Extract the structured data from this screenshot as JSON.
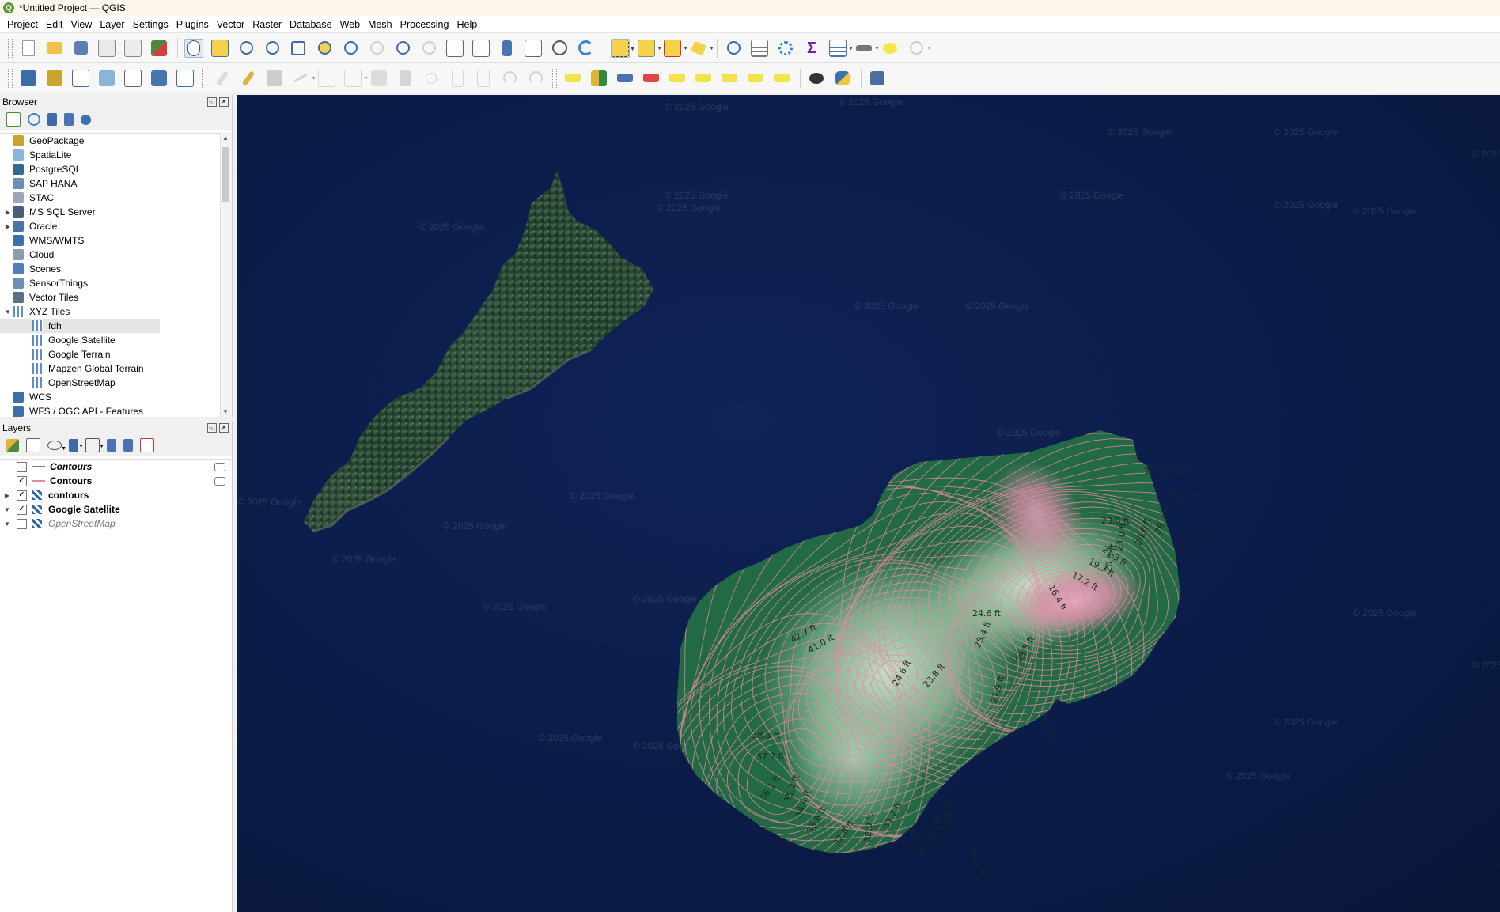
{
  "window": {
    "title": "*Untitled Project — QGIS",
    "logo": "Q"
  },
  "menu": [
    "Project",
    "Edit",
    "View",
    "Layer",
    "Settings",
    "Plugins",
    "Vector",
    "Raster",
    "Database",
    "Web",
    "Mesh",
    "Processing",
    "Help"
  ],
  "browser": {
    "title": "Browser",
    "items": [
      {
        "label": "GeoPackage",
        "icon": "geopackage-icon",
        "expand": "",
        "indent": 0,
        "color": "#c9a431"
      },
      {
        "label": "SpatiaLite",
        "icon": "spatialite-icon",
        "expand": "",
        "indent": 0,
        "color": "#8ab4d8"
      },
      {
        "label": "PostgreSQL",
        "icon": "postgresql-icon",
        "expand": "",
        "indent": 0,
        "color": "#336791"
      },
      {
        "label": "SAP HANA",
        "icon": "sap-hana-icon",
        "expand": "",
        "indent": 0,
        "color": "#6c8fb8"
      },
      {
        "label": "STAC",
        "icon": "stac-icon",
        "expand": "",
        "indent": 0,
        "color": "#9aa7b6"
      },
      {
        "label": "MS SQL Server",
        "icon": "mssql-icon",
        "expand": "▶",
        "indent": 0,
        "color": "#4b5d73"
      },
      {
        "label": "Oracle",
        "icon": "oracle-icon",
        "expand": "▶",
        "indent": 0,
        "color": "#4a73a8"
      },
      {
        "label": "WMS/WMTS",
        "icon": "wms-icon",
        "expand": "",
        "indent": 0,
        "color": "#3d6fa8"
      },
      {
        "label": "Cloud",
        "icon": "cloud-icon",
        "expand": "",
        "indent": 0,
        "color": "#8c9cb0"
      },
      {
        "label": "Scenes",
        "icon": "scenes-icon",
        "expand": "",
        "indent": 0,
        "color": "#4f7fb5"
      },
      {
        "label": "SensorThings",
        "icon": "sensorthings-icon",
        "expand": "",
        "indent": 0,
        "color": "#6f8fb2"
      },
      {
        "label": "Vector Tiles",
        "icon": "vector-tiles-icon",
        "expand": "",
        "indent": 0,
        "color": "#5b6f88"
      },
      {
        "label": "XYZ Tiles",
        "icon": "xyz-tiles-icon",
        "expand": "▼",
        "indent": 0,
        "color": "#5d8fc8"
      },
      {
        "label": "fdh",
        "icon": "xyz-tile-icon",
        "expand": "",
        "indent": 1,
        "color": "#5d8fc8",
        "selected": true
      },
      {
        "label": "Google Satellite",
        "icon": "xyz-tile-icon",
        "expand": "",
        "indent": 1,
        "color": "#5d8fc8"
      },
      {
        "label": "Google Terrain",
        "icon": "xyz-tile-icon",
        "expand": "",
        "indent": 1,
        "color": "#5d8fc8"
      },
      {
        "label": "Mapzen Global Terrain",
        "icon": "xyz-tile-icon",
        "expand": "",
        "indent": 1,
        "color": "#5d8fc8"
      },
      {
        "label": "OpenStreetMap",
        "icon": "xyz-tile-icon",
        "expand": "",
        "indent": 1,
        "color": "#5d8fc8"
      },
      {
        "label": "WCS",
        "icon": "wcs-icon",
        "expand": "",
        "indent": 0,
        "color": "#3d6fa8"
      },
      {
        "label": "WFS / OGC API - Features",
        "icon": "wfs-icon",
        "expand": "",
        "indent": 0,
        "color": "#3d6fa8"
      }
    ]
  },
  "layers": {
    "title": "Layers",
    "items": [
      {
        "label": "Contours",
        "checked": false,
        "symbol": "line",
        "style": "bold italic underline",
        "expand": ""
      },
      {
        "label": "Contours",
        "checked": true,
        "symbol": "pink",
        "style": "bold",
        "expand": ""
      },
      {
        "label": "contours",
        "checked": true,
        "symbol": "ras",
        "style": "bold",
        "expand": "▶"
      },
      {
        "label": "Google Satellite",
        "checked": true,
        "symbol": "ras",
        "style": "bold",
        "expand": "▼"
      },
      {
        "label": "OpenStreetMap",
        "checked": false,
        "symbol": "ras",
        "style": "italic grey",
        "expand": "▼"
      }
    ]
  },
  "map": {
    "watermark": "© 2025 Google",
    "contour_labels": [
      "28.7 ft",
      "27.9 ft",
      "27.1 ft",
      "23.8 ft",
      "26.2 ft",
      "24.6 ft",
      "21.3 ft",
      "23.0 ft",
      "19.7 ft",
      "20.5 ft",
      "17.2 ft",
      "16.4 ft",
      "28.7 ft",
      "24.6 ft",
      "25.4 ft",
      "29.5 ft",
      "24.6 ft",
      "23.8 ft",
      "27.9 ft",
      "30.3 ft",
      "42.7 ft",
      "41.0 ft",
      "38.5 ft",
      "37.7 ft",
      "36.1 ft",
      "35.2 ft",
      "34.4 ft",
      "33.6 ft",
      "32.8 ft",
      "32.0 ft",
      "31.2 ft",
      "30.3 ft",
      "29.5 ft",
      "29.5 ft",
      "30.3 ft"
    ]
  },
  "colors": {
    "water": "#0b1c48",
    "dem_dark": "#216a45",
    "dem_light": "#b7d6ba",
    "dem_pink": "#e28fae",
    "contour": "#e48aa0"
  }
}
